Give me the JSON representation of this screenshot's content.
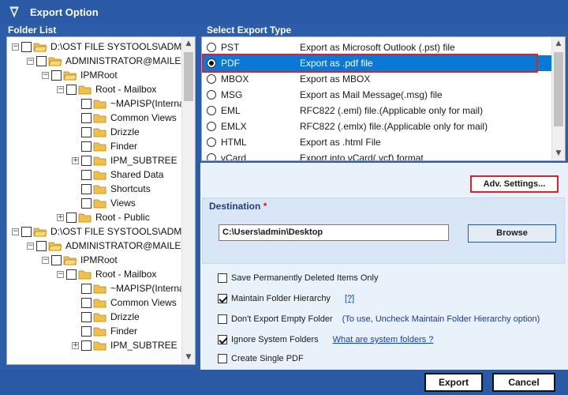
{
  "window": {
    "title": "Export Option"
  },
  "folder_list": {
    "label": "Folder List",
    "rows": [
      {
        "indent": 0,
        "expander": "-",
        "checkbox": true,
        "folder": "open",
        "text": "D:\\OST FILE SYSTOOLS\\ADMINIS"
      },
      {
        "indent": 1,
        "expander": "-",
        "checkbox": true,
        "folder": "open",
        "text": "ADMINISTRATOR@MAILEXC"
      },
      {
        "indent": 2,
        "expander": "-",
        "checkbox": true,
        "folder": "open",
        "text": "IPMRoot"
      },
      {
        "indent": 3,
        "expander": "-",
        "checkbox": true,
        "folder": "closed",
        "text": "Root - Mailbox"
      },
      {
        "indent": 4,
        "expander": "",
        "checkbox": true,
        "folder": "closed",
        "text": "~MAPISP(Interna"
      },
      {
        "indent": 4,
        "expander": "",
        "checkbox": true,
        "folder": "closed",
        "text": "Common Views"
      },
      {
        "indent": 4,
        "expander": "",
        "checkbox": true,
        "folder": "closed",
        "text": "Drizzle"
      },
      {
        "indent": 4,
        "expander": "",
        "checkbox": true,
        "folder": "closed",
        "text": "Finder"
      },
      {
        "indent": 4,
        "expander": "+",
        "checkbox": true,
        "folder": "closed",
        "text": "IPM_SUBTREE"
      },
      {
        "indent": 4,
        "expander": "",
        "checkbox": true,
        "folder": "closed",
        "text": "Shared Data"
      },
      {
        "indent": 4,
        "expander": "",
        "checkbox": true,
        "folder": "closed",
        "text": "Shortcuts"
      },
      {
        "indent": 4,
        "expander": "",
        "checkbox": true,
        "folder": "closed",
        "text": "Views"
      },
      {
        "indent": 3,
        "expander": "+",
        "checkbox": true,
        "folder": "closed",
        "text": "Root - Public"
      },
      {
        "indent": 0,
        "expander": "-",
        "checkbox": true,
        "folder": "open",
        "text": "D:\\OST FILE SYSTOOLS\\ADMINIS"
      },
      {
        "indent": 1,
        "expander": "-",
        "checkbox": true,
        "folder": "open",
        "text": "ADMINISTRATOR@MAILEXC"
      },
      {
        "indent": 2,
        "expander": "-",
        "checkbox": true,
        "folder": "open",
        "text": "IPMRoot"
      },
      {
        "indent": 3,
        "expander": "-",
        "checkbox": true,
        "folder": "closed",
        "text": "Root - Mailbox"
      },
      {
        "indent": 4,
        "expander": "",
        "checkbox": true,
        "folder": "closed",
        "text": "~MAPISP(Interna"
      },
      {
        "indent": 4,
        "expander": "",
        "checkbox": true,
        "folder": "closed",
        "text": "Common Views"
      },
      {
        "indent": 4,
        "expander": "",
        "checkbox": true,
        "folder": "closed",
        "text": "Drizzle"
      },
      {
        "indent": 4,
        "expander": "",
        "checkbox": true,
        "folder": "closed",
        "text": "Finder"
      },
      {
        "indent": 4,
        "expander": "+",
        "checkbox": true,
        "folder": "closed",
        "text": "IPM_SUBTREE"
      }
    ]
  },
  "export_type": {
    "label": "Select Export Type",
    "selected": "PDF",
    "options": [
      {
        "code": "PST",
        "desc": "Export as Microsoft Outlook (.pst) file"
      },
      {
        "code": "PDF",
        "desc": "Export as .pdf file"
      },
      {
        "code": "MBOX",
        "desc": "Export as MBOX"
      },
      {
        "code": "MSG",
        "desc": "Export as Mail Message(.msg) file"
      },
      {
        "code": "EML",
        "desc": "RFC822 (.eml) file.(Applicable only for mail)"
      },
      {
        "code": "EMLX",
        "desc": "RFC822 (.emlx) file.(Applicable only for mail)"
      },
      {
        "code": "HTML",
        "desc": "Export as .html File"
      },
      {
        "code": "vCard",
        "desc": "Export into vCard(.vcf) format"
      }
    ]
  },
  "adv_settings_label": "Adv. Settings...",
  "destination": {
    "label": "Destination",
    "required_mark": "*",
    "value": "C:\\Users\\admin\\Desktop",
    "browse_label": "Browse"
  },
  "options": {
    "save_deleted": {
      "label": "Save Permanently Deleted Items Only",
      "checked": false
    },
    "maintain_hierarchy": {
      "label": "Maintain Folder Hierarchy",
      "checked": true,
      "help": "[?]"
    },
    "dont_export_empty": {
      "label": "Don't Export Empty Folder",
      "checked": false,
      "note": "(To use, Uncheck Maintain Folder Hierarchy option)"
    },
    "ignore_system": {
      "label": "Ignore System Folders",
      "checked": true,
      "link": "What are system folders ?"
    },
    "single_pdf": {
      "label": "Create Single PDF",
      "checked": false
    }
  },
  "footer": {
    "export_label": "Export",
    "cancel_label": "Cancel"
  },
  "colors": {
    "titlebar": "#2a5aa6",
    "selection": "#0a79d6",
    "highlight": "#e0202a",
    "folder": "#f2c04a"
  }
}
